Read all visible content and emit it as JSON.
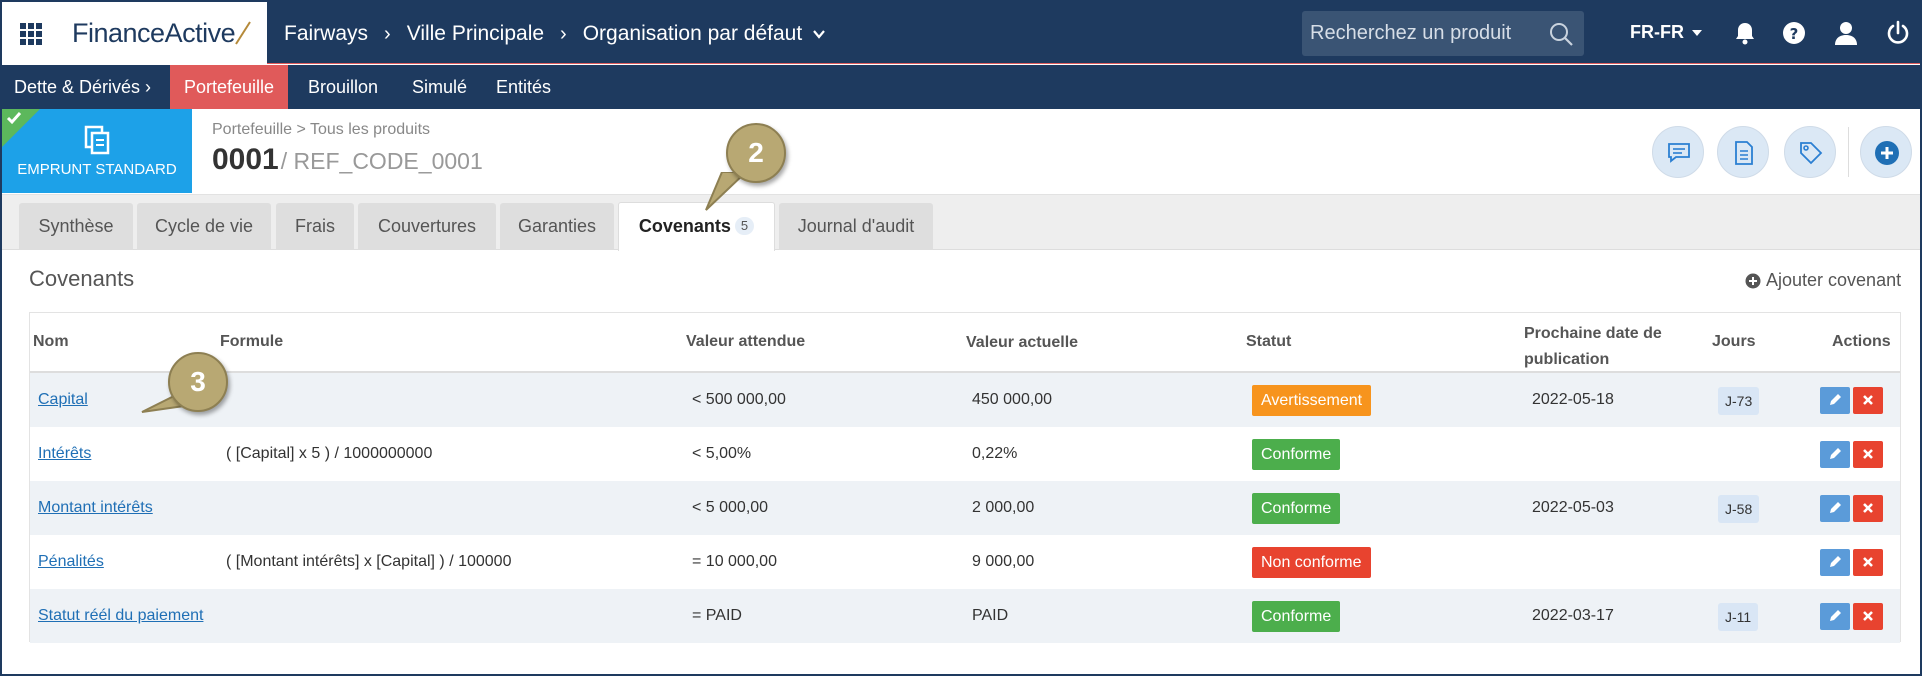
{
  "header": {
    "logo_prefix": "Finance",
    "logo_suffix": "Active",
    "breadcrumb": [
      "Fairways",
      "Ville Principale",
      "Organisation par défaut"
    ],
    "search_placeholder": "Recherchez un produit",
    "language": "FR-FR"
  },
  "subnav": {
    "items": [
      "Dette & Dérivés",
      "Portefeuille",
      "Brouillon",
      "Simulé",
      "Entités"
    ],
    "active_index": 1
  },
  "product": {
    "badge_label": "EMPRUNT STANDARD",
    "breadcrumb": "Portefeuille > Tous les produits",
    "code": "0001",
    "ref": "/ REF_CODE_0001"
  },
  "tabs": [
    {
      "label": "Synthèse"
    },
    {
      "label": "Cycle de vie"
    },
    {
      "label": "Frais"
    },
    {
      "label": "Couvertures"
    },
    {
      "label": "Garanties"
    },
    {
      "label": "Covenants",
      "count": "5",
      "active": true
    },
    {
      "label": "Journal d'audit"
    }
  ],
  "section": {
    "title": "Covenants",
    "add_label": "Ajouter covenant"
  },
  "table": {
    "columns": {
      "nom": "Nom",
      "formule": "Formule",
      "valeur_attendue": "Valeur attendue",
      "valeur_actuelle": "Valeur actuelle",
      "statut": "Statut",
      "date_line1": "Prochaine date de",
      "date_line2": "publication",
      "jours": "Jours",
      "actions": "Actions"
    },
    "rows": [
      {
        "nom": "Capital",
        "formule": "",
        "attendue": "< 500 000,00",
        "actuelle": "450 000,00",
        "statut": "Avertissement",
        "date": "2022-05-18",
        "jours": "J-73"
      },
      {
        "nom": "Intérêts",
        "formule": "( [Capital] x 5 ) / 1000000000",
        "attendue": "< 5,00%",
        "actuelle": "0,22%",
        "statut": "Conforme",
        "date": "",
        "jours": ""
      },
      {
        "nom": "Montant intérêts",
        "formule": "",
        "attendue": "< 5 000,00",
        "actuelle": "2 000,00",
        "statut": "Conforme",
        "date": "2022-05-03",
        "jours": "J-58"
      },
      {
        "nom": "Pénalités",
        "formule": "( [Montant intérêts] x [Capital] ) / 100000",
        "attendue": "= 10 000,00",
        "actuelle": "9 000,00",
        "statut": "Non conforme",
        "date": "",
        "jours": ""
      },
      {
        "nom": "Statut réél du paiement",
        "formule": "",
        "attendue": "= PAID",
        "actuelle": "PAID",
        "statut": "Conforme",
        "date": "2022-03-17",
        "jours": "J-11"
      }
    ]
  },
  "callouts": [
    "2",
    "3"
  ],
  "colors": {
    "navy": "#1e3a5f",
    "accent_red": "#e05a5a",
    "badge_blue": "#1da1e8",
    "warning": "#f7941d",
    "success": "#4cae4c",
    "danger": "#e8432f",
    "edit_blue": "#5b9bd9"
  }
}
